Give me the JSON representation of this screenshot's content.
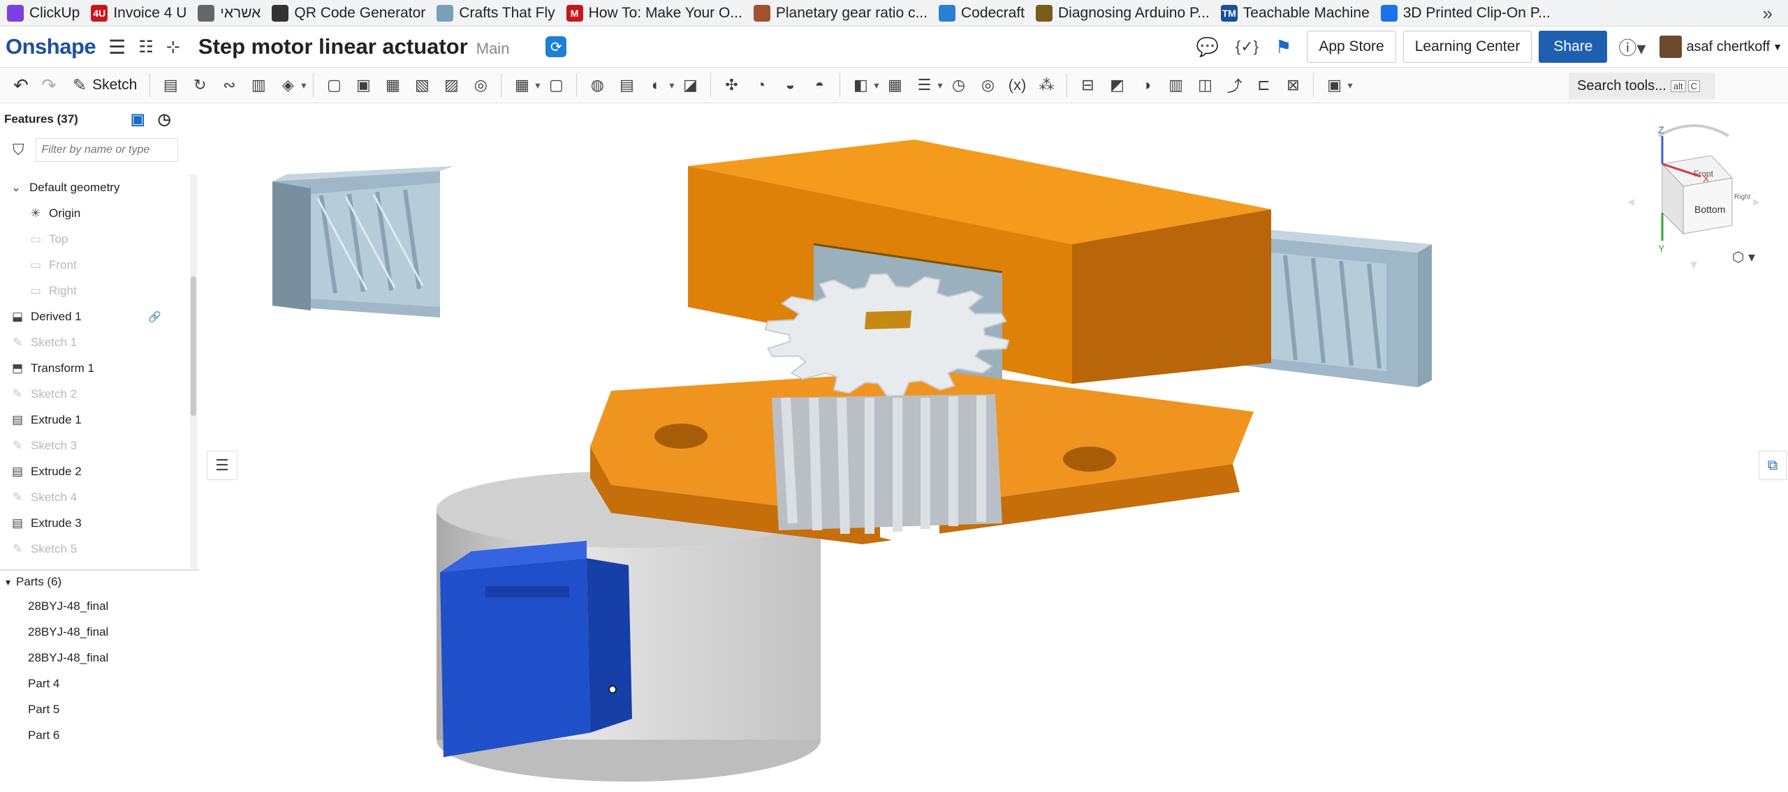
{
  "bookmarks": [
    {
      "label": "ClickUp",
      "icon": "clickup-icon",
      "color": "#7b3fe4"
    },
    {
      "label": "Invoice 4 U",
      "icon": "invoice-icon",
      "color": "#c8161d",
      "glyph": "4U"
    },
    {
      "label": "אשראי",
      "icon": "folder-icon",
      "color": "#666666"
    },
    {
      "label": "QR Code Generator",
      "icon": "qr-icon",
      "color": "#333333"
    },
    {
      "label": "Crafts That Fly",
      "icon": "plane-icon",
      "color": "#7aa0b8"
    },
    {
      "label": "How To: Make Your O...",
      "icon": "m-icon",
      "color": "#c8161d",
      "glyph": "M"
    },
    {
      "label": "Planetary gear ratio c...",
      "icon": "gear-bookmark-icon",
      "color": "#a0522d"
    },
    {
      "label": "Codecraft",
      "icon": "codecraft-icon",
      "color": "#2a7fd4"
    },
    {
      "label": "Diagnosing Arduino P...",
      "icon": "board-icon",
      "color": "#7a5c1e"
    },
    {
      "label": "Teachable Machine",
      "icon": "tm-icon",
      "color": "#1a4f9c",
      "glyph": "TM"
    },
    {
      "label": "3D Printed Clip-On P...",
      "icon": "globe-icon",
      "color": "#1a73e8"
    }
  ],
  "bookmarks_more": "»",
  "app": {
    "logo": "Onshape",
    "doc_title": "Step motor linear actuator",
    "branch": "Main",
    "app_store": "App Store",
    "learning_center": "Learning Center",
    "share": "Share",
    "user": "asaf chertkoff",
    "help": "?",
    "brand_color": "#1f4f9c",
    "accent": "#1f5fb0"
  },
  "toolbar": {
    "sketch_label": "Sketch",
    "search_label": "Search tools...",
    "search_kbd_1": "alt",
    "search_kbd_2": "C"
  },
  "features": {
    "title": "Features (37)",
    "filter_placeholder": "Filter by name or type",
    "items": [
      {
        "label": "Default geometry",
        "kind": "group",
        "icon": "chevron-down-icon"
      },
      {
        "label": "Origin",
        "kind": "plane",
        "icon": "origin-icon"
      },
      {
        "label": "Top",
        "kind": "plane",
        "dim": true,
        "icon": "plane-icon"
      },
      {
        "label": "Front",
        "kind": "plane",
        "dim": true,
        "icon": "plane-icon"
      },
      {
        "label": "Right",
        "kind": "plane",
        "dim": true,
        "icon": "plane-icon"
      },
      {
        "label": "Derived 1",
        "kind": "feat",
        "icon": "derived-icon",
        "link": true
      },
      {
        "label": "Sketch 1",
        "kind": "feat",
        "dim": true,
        "icon": "sketch-icon"
      },
      {
        "label": "Transform 1",
        "kind": "feat",
        "icon": "transform-icon"
      },
      {
        "label": "Sketch 2",
        "kind": "feat",
        "dim": true,
        "icon": "sketch-icon"
      },
      {
        "label": "Extrude 1",
        "kind": "feat",
        "icon": "extrude-icon"
      },
      {
        "label": "Sketch 3",
        "kind": "feat",
        "dim": true,
        "icon": "sketch-icon"
      },
      {
        "label": "Extrude 2",
        "kind": "feat",
        "icon": "extrude-icon"
      },
      {
        "label": "Sketch 4",
        "kind": "feat",
        "dim": true,
        "icon": "sketch-icon"
      },
      {
        "label": "Extrude 3",
        "kind": "feat",
        "icon": "extrude-icon"
      },
      {
        "label": "Sketch 5",
        "kind": "feat",
        "dim": true,
        "icon": "sketch-icon"
      }
    ]
  },
  "parts": {
    "title": "Parts (6)",
    "items": [
      "28BYJ-48_final",
      "28BYJ-48_final",
      "28BYJ-48_final",
      "Part 4",
      "Part 5",
      "Part 6"
    ]
  },
  "view_cube": {
    "front": "Front",
    "bottom": "Bottom",
    "right": "Right",
    "axis_x": "X",
    "axis_y": "Y",
    "axis_z": "Z"
  },
  "model_colors": {
    "bracket": "#e58a0c",
    "rack": "#a9c2d2",
    "gear": "#d9dde0",
    "motor": "#d3d3d3",
    "connector": "#1f4fc9",
    "shaft": "#d9a227"
  }
}
